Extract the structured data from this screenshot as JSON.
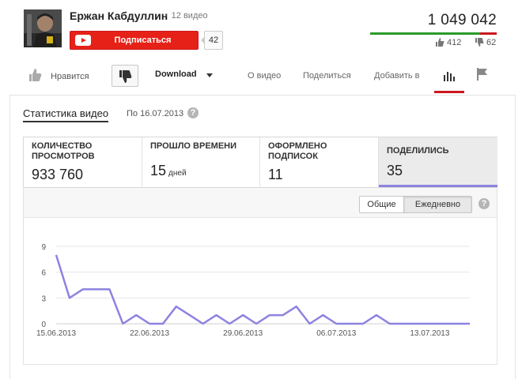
{
  "channel": {
    "name": "Ержан Кабдуллин",
    "video_count": "12 видео",
    "subscribe_label": "Подписаться",
    "subscriber_count": "42"
  },
  "stats_summary": {
    "views": "1 049 042",
    "likes": "412",
    "dislikes": "62",
    "likes_ratio": 0.87,
    "like_color": "#2a9b2a",
    "dislike_color": "#cc181e"
  },
  "actions": {
    "like_label": "Нравится",
    "download_label": "Download",
    "tabs": [
      {
        "label": "О видео"
      },
      {
        "label": "Поделиться"
      },
      {
        "label": "Добавить в"
      }
    ]
  },
  "statistics": {
    "title": "Статистика видео",
    "date": "По 16.07.2013",
    "help": "?",
    "metrics": [
      {
        "label": "Количество просмотров",
        "value": "933 760",
        "unit": ""
      },
      {
        "label": "Прошло времени",
        "value": "15",
        "unit": "дней"
      },
      {
        "label": "Оформлено подписок",
        "value": "11",
        "unit": ""
      },
      {
        "label": "Поделились",
        "value": "35",
        "unit": ""
      }
    ],
    "toggle": {
      "total": "Общие",
      "daily": "Ежедневно"
    }
  },
  "chart_data": {
    "type": "line",
    "x": [
      "15.06.2013",
      "16.06.2013",
      "17.06.2013",
      "18.06.2013",
      "19.06.2013",
      "20.06.2013",
      "21.06.2013",
      "22.06.2013",
      "23.06.2013",
      "24.06.2013",
      "25.06.2013",
      "26.06.2013",
      "27.06.2013",
      "28.06.2013",
      "29.06.2013",
      "30.06.2013",
      "01.07.2013",
      "02.07.2013",
      "03.07.2013",
      "04.07.2013",
      "05.07.2013",
      "06.07.2013",
      "07.07.2013",
      "08.07.2013",
      "09.07.2013",
      "10.07.2013",
      "11.07.2013",
      "12.07.2013",
      "13.07.2013",
      "14.07.2013",
      "15.07.2013",
      "16.07.2013"
    ],
    "series": [
      {
        "values": [
          8,
          3,
          4,
          4,
          4,
          0,
          1,
          0,
          0,
          2,
          1,
          0,
          1,
          0,
          1,
          0,
          1,
          1,
          2,
          0,
          1,
          0,
          0,
          0,
          1,
          0,
          0,
          0,
          0,
          0,
          0,
          0
        ],
        "color": "#8d83e0"
      }
    ],
    "x_tick_labels": [
      "15.06.2013",
      "22.06.2013",
      "29.06.2013",
      "06.07.2013",
      "13.07.2013"
    ],
    "y_ticks": [
      0,
      3,
      6,
      9
    ],
    "ylim": [
      0,
      9
    ],
    "grid": true
  }
}
